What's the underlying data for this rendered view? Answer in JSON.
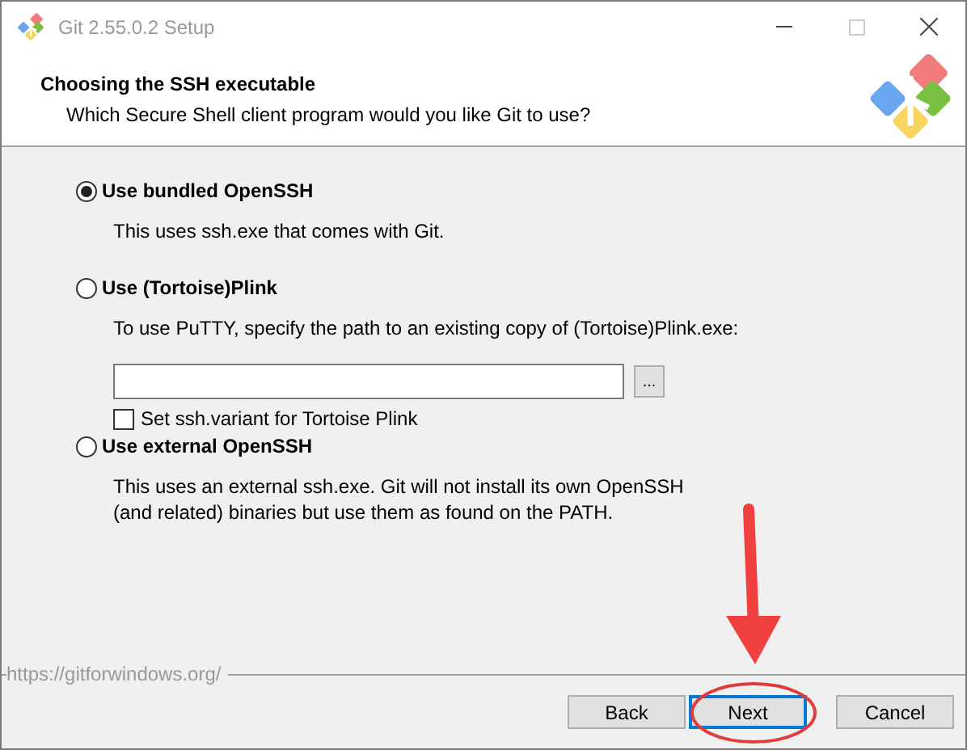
{
  "window": {
    "title": "Git 2.55.0.2 Setup"
  },
  "header": {
    "title": "Choosing the SSH executable",
    "subtitle": "Which Secure Shell client program would you like Git to use?"
  },
  "options": [
    {
      "label": "Use bundled OpenSSH",
      "selected": true,
      "description": [
        "This uses ssh.exe that comes with Git."
      ]
    },
    {
      "label": "Use (Tortoise)Plink",
      "selected": false,
      "description": [
        "To use PuTTY, specify the path to an existing copy of (Tortoise)Plink.exe:"
      ],
      "path_field": {
        "browse_label": "..."
      },
      "checkbox": {
        "label": "Set ssh.variant for Tortoise Plink",
        "checked": false
      }
    },
    {
      "label": "Use external OpenSSH",
      "selected": false,
      "description": [
        "This uses an external ssh.exe. Git will not install its own OpenSSH",
        "(and related) binaries but use them as found on the PATH."
      ]
    }
  ],
  "footer": {
    "link": "https://gitforwindows.org/",
    "buttons": [
      {
        "label": "Back",
        "focused": false
      },
      {
        "label": "Next",
        "focused": true
      },
      {
        "label": "Cancel",
        "focused": false
      }
    ]
  }
}
